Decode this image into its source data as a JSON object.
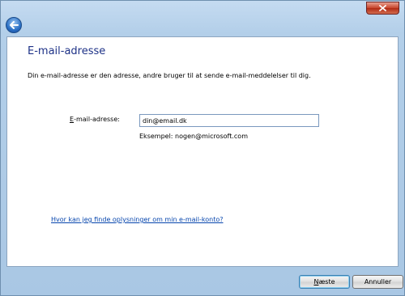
{
  "titlebar": {
    "close_icon": "close-icon",
    "back_icon": "back-arrow-icon"
  },
  "wizard": {
    "title": "E-mail-adresse",
    "intro": "Din e-mail-adresse er den adresse, andre bruger til at sende e-mail-meddelelser til dig.",
    "email_label_underlined": "E",
    "email_label_rest": "-mail-adresse:",
    "email_value": "din@email.dk",
    "example": "Eksempel: nogen@microsoft.com",
    "help_link": "Hvor kan jeg finde oplysninger om min e-mail-konto?"
  },
  "footer": {
    "next_underlined": "N",
    "next_rest": "æste",
    "cancel": "Annuller"
  },
  "colors": {
    "title": "#1e3287",
    "link": "#0645ad",
    "frame": "#b3cfe9"
  }
}
